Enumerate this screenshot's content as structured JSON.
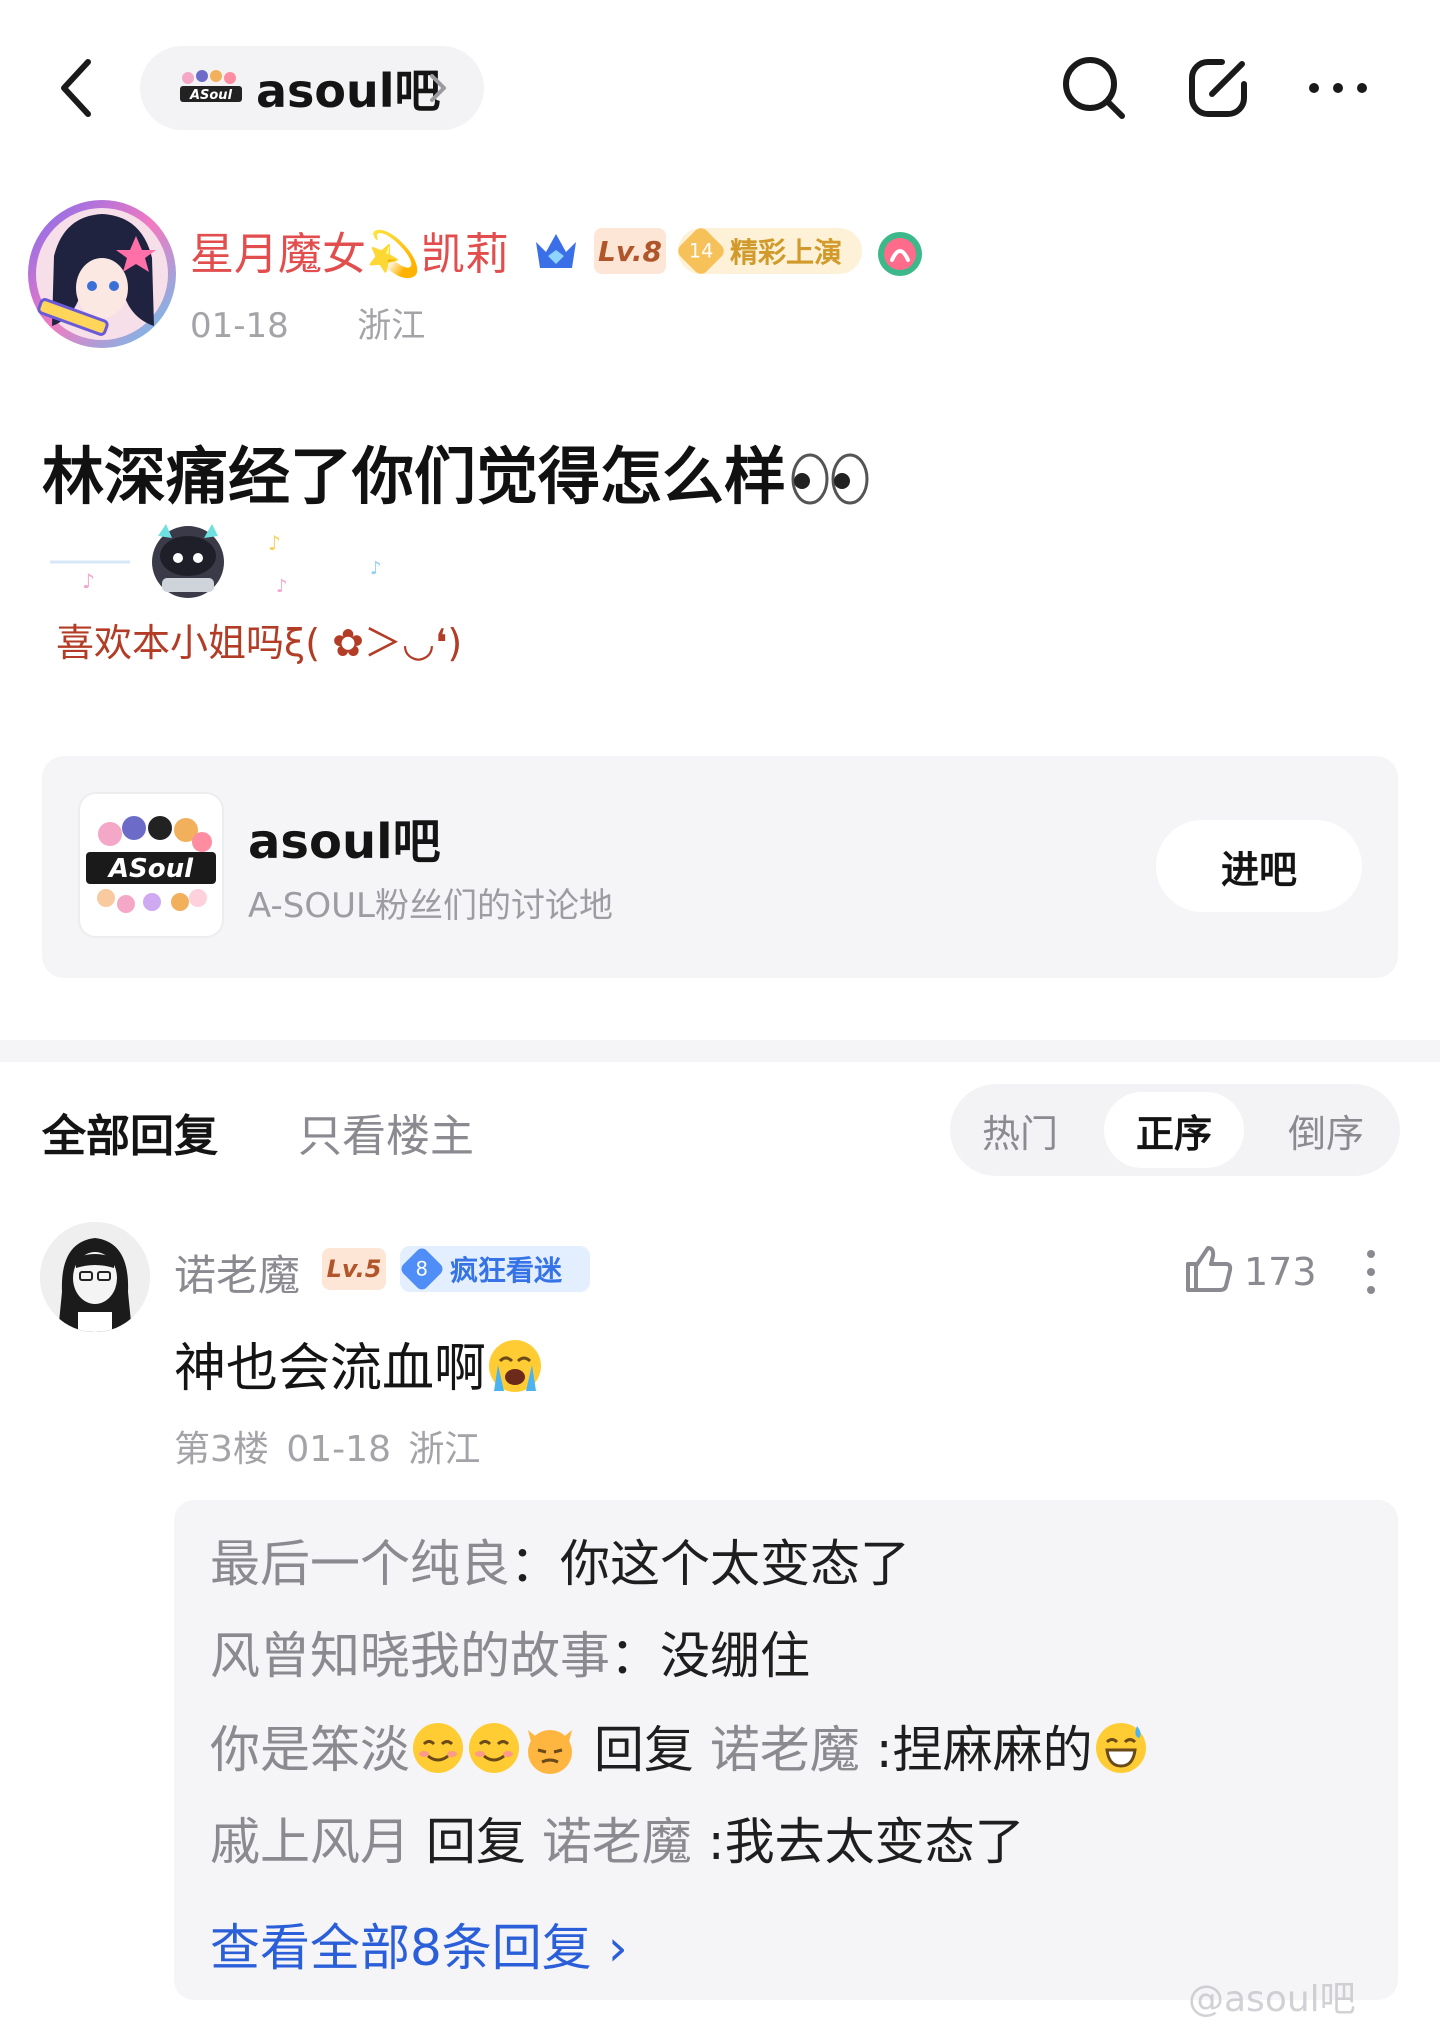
{
  "topbar": {
    "forum_name": "asoul吧",
    "icons": [
      "back-icon",
      "search-icon",
      "compose-icon",
      "more-icon"
    ]
  },
  "author": {
    "name": "星月魔女💫凯莉",
    "level": "Lv.8",
    "tag_number": "14",
    "tag_label": "精彩上演",
    "date": "01-18",
    "location": "浙江"
  },
  "post": {
    "title": "林深痛经了你们觉得怎么样",
    "signature": "喜欢本小姐吗ξ( ✿＞◡❛)"
  },
  "forum_card": {
    "name": "asoul吧",
    "description": "A-SOUL粉丝们的讨论地",
    "enter_label": "进吧"
  },
  "reply_tabs": {
    "all": "全部回复",
    "op_only": "只看楼主",
    "sort": {
      "hot": "热门",
      "asc": "正序",
      "desc": "倒序",
      "selected": "正序"
    }
  },
  "reply": {
    "user": "诺老魔",
    "level": "Lv.5",
    "badge_number": "8",
    "badge_label": "疯狂看迷",
    "likes": "173",
    "text": "神也会流血啊",
    "floor": "第3楼",
    "date": "01-18",
    "location": "浙江",
    "sub_replies": [
      {
        "user": "最后一个纯良",
        "sep": "：",
        "text": "你这个太变态了"
      },
      {
        "user": "风曾知晓我的故事",
        "sep": "：",
        "text": "没绷住"
      },
      {
        "user": "你是笨淡",
        "reply_word": "回复",
        "target": "诺老魔",
        "text": ":捏麻麻的"
      },
      {
        "user": "戚上风月",
        "reply_word": "回复",
        "target": "诺老魔",
        "text": ":我去太变态了"
      }
    ],
    "view_all": "查看全部8条回复 ›"
  },
  "watermark": "@asoul吧"
}
